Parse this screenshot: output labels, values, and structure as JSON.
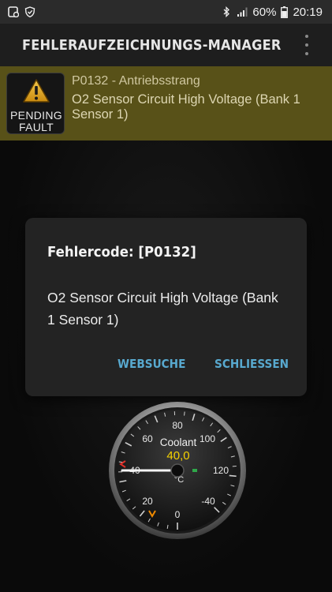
{
  "status_bar": {
    "battery": "60%",
    "time": "20:19",
    "icons": [
      "notification-icon",
      "shield-icon",
      "bluetooth-icon",
      "signal-icon",
      "battery-icon"
    ]
  },
  "app_bar": {
    "title": "FEHLERAUFZEICHNUNGS-MANAGER",
    "menu_icon": "overflow-menu-icon"
  },
  "fault_item": {
    "badge_line1": "PENDING",
    "badge_line2": "FAULT",
    "code_line": "P0132 - Antriebsstrang",
    "description": "O2 Sensor Circuit High Voltage (Bank 1 Sensor 1)",
    "icon": "warning-icon"
  },
  "dialog": {
    "title": "Fehlercode: [P0132]",
    "body": "O2 Sensor Circuit High Voltage (Bank 1 Sensor 1)",
    "buttons": {
      "websearch": "WEBSUCHE",
      "close": "SCHLIESSEN"
    }
  },
  "gauge": {
    "label": "Coolant",
    "value_text": "40,0",
    "value": 40.0,
    "unit": "°C",
    "tick_labels": [
      "-40",
      "0",
      "20",
      "40",
      "60",
      "80",
      "100",
      "120"
    ],
    "colors": {
      "value": "#f5d200",
      "accent_red": "#e0302a",
      "accent_orange": "#f08a00"
    }
  }
}
